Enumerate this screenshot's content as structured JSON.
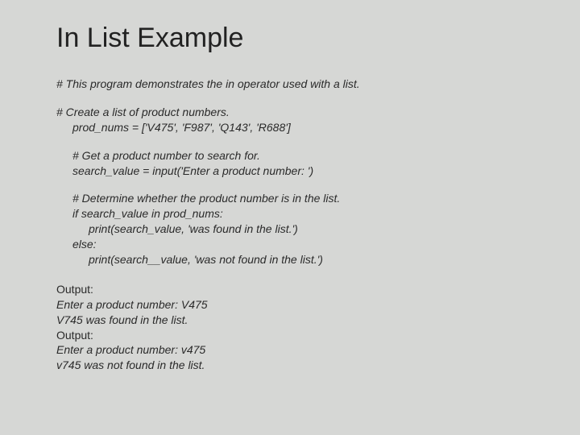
{
  "title": "In List Example",
  "code": {
    "c1": "# This program demonstrates the in operator used with a list.",
    "c2": "# Create a list of product numbers.",
    "c3": "prod_nums = ['V475', 'F987', 'Q143', 'R688']",
    "c4": "# Get a product number to search for.",
    "c5": "search_value = input('Enter a product number: ')",
    "c6": "# Determine whether the product number is in the list.",
    "c7": "if search_value in prod_nums:",
    "c8": "print(search_value, 'was found in the list.')",
    "c9": "else:",
    "c10": "print(search__value, 'was not found in the list.')"
  },
  "output": {
    "label1": "Output:",
    "o1": "Enter a product number: V475",
    "o2": "V745 was found in the list.",
    "label2": "Output:",
    "o3": "Enter a product number: v475",
    "o4": "v745 was not found in the list."
  }
}
